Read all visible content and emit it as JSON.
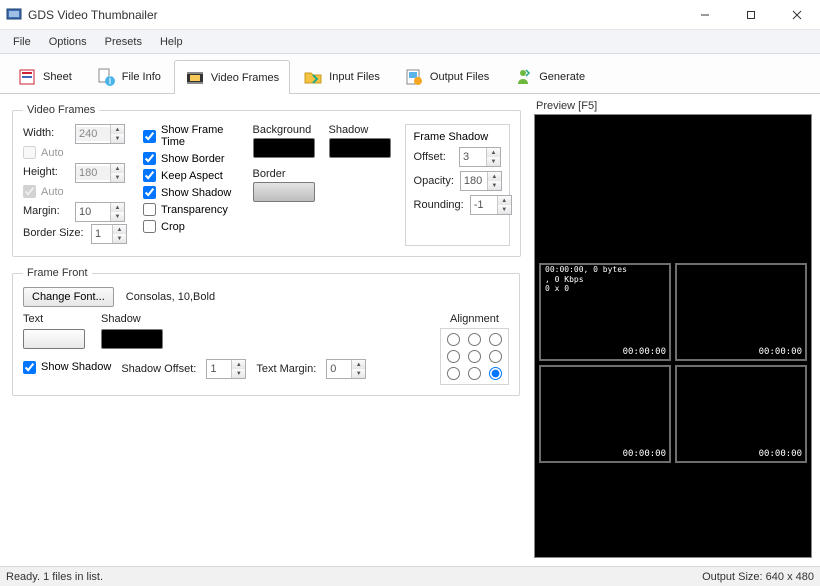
{
  "title": "GDS Video Thumbnailer",
  "menu": {
    "file": "File",
    "options": "Options",
    "presets": "Presets",
    "help": "Help"
  },
  "tabs": {
    "sheet": "Sheet",
    "file_info": "File Info",
    "video_frames": "Video Frames",
    "input_files": "Input Files",
    "output_files": "Output Files",
    "generate": "Generate"
  },
  "video_frames": {
    "legend": "Video Frames",
    "width_label": "Width:",
    "width_value": "240",
    "width_auto": "Auto",
    "height_label": "Height:",
    "height_value": "180",
    "height_auto": "Auto",
    "margin_label": "Margin:",
    "margin_value": "10",
    "border_size_label": "Border Size:",
    "border_size_value": "1",
    "show_frame_time": "Show Frame Time",
    "show_border": "Show Border",
    "keep_aspect": "Keep Aspect",
    "show_shadow": "Show Shadow",
    "transparency": "Transparency",
    "crop": "Crop",
    "background_label": "Background",
    "shadow_label": "Shadow",
    "border_label": "Border",
    "frame_shadow": {
      "legend": "Frame Shadow",
      "offset_label": "Offset:",
      "offset_value": "3",
      "opacity_label": "Opacity:",
      "opacity_value": "180",
      "rounding_label": "Rounding:",
      "rounding_value": "-1"
    }
  },
  "frame_front": {
    "legend": "Frame Front",
    "change_font": "Change Font...",
    "font_desc": "Consolas, 10,Bold",
    "text_label": "Text",
    "shadow_label": "Shadow",
    "show_shadow": "Show Shadow",
    "shadow_offset_label": "Shadow Offset:",
    "shadow_offset_value": "1",
    "text_margin_label": "Text Margin:",
    "text_margin_value": "0",
    "alignment_label": "Alignment"
  },
  "preview": {
    "label": "Preview  [F5]",
    "info": "00:00:00, 0 bytes\n, 0 Kbps\n0 x 0",
    "timestamps": [
      "00:00:00",
      "00:00:00",
      "00:00:00",
      "00:00:00"
    ]
  },
  "status": {
    "left": "Ready. 1 files in list.",
    "right": "Output Size: 640 x 480"
  }
}
